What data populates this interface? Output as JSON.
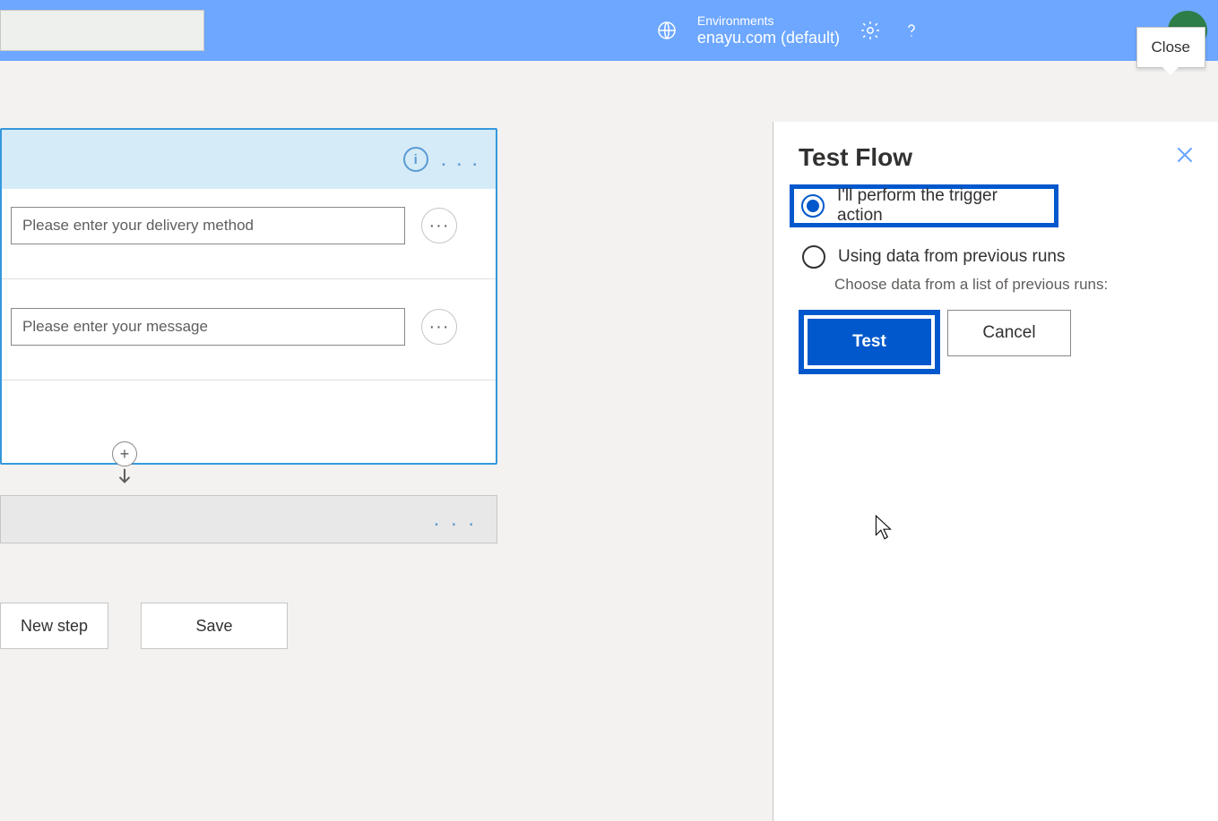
{
  "header": {
    "env_label": "Environments",
    "env_name": "enayu.com (default)",
    "close_tooltip": "Close"
  },
  "trigger": {
    "info_char": "i",
    "dots": ". . .",
    "inputs": [
      {
        "placeholder": "Please enter your delivery method"
      },
      {
        "placeholder": "Please enter your message"
      }
    ]
  },
  "action": {
    "dots": ". . ."
  },
  "footer": {
    "new_step": "New step",
    "save": "Save"
  },
  "test_panel": {
    "title": "Test Flow",
    "option1": "I'll perform the trigger action",
    "option2": "Using data from previous runs",
    "option2_sub": "Choose data from a list of previous runs:",
    "test_btn": "Test",
    "cancel_btn": "Cancel"
  }
}
